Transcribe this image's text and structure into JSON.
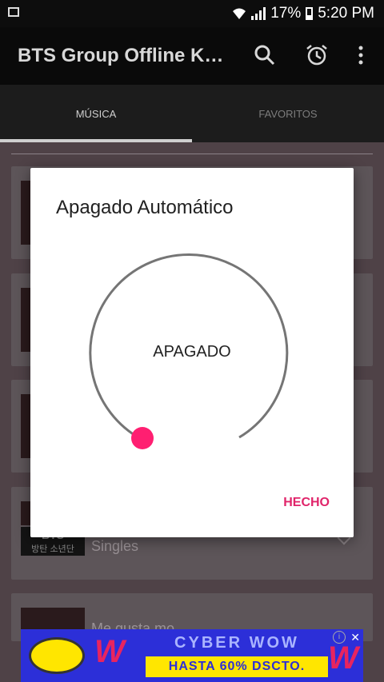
{
  "status_bar": {
    "battery_percent": "17%",
    "time": "5:20 PM"
  },
  "app_bar": {
    "title": "BTS Group Offline K…",
    "icons": [
      "search-icon",
      "alarm-icon",
      "more-vert-icon"
    ]
  },
  "tabs": [
    {
      "label": "MÚSICA",
      "selected": true
    },
    {
      "label": "FAVORITOS",
      "selected": false
    }
  ],
  "list": {
    "items": [
      {
        "label": ""
      },
      {
        "label": ""
      },
      {
        "label": ""
      },
      {
        "label": "Singles",
        "logo_text": "BTS\n방탄 소년단"
      },
      {
        "label": "Me gusta mo"
      }
    ]
  },
  "dialog": {
    "title": "Apagado Automático",
    "dial_value": "APAGADO",
    "done_label": "HECHO"
  },
  "ad": {
    "line1": "CYBER WOW",
    "line2": "HASTA 60% DSCTO."
  },
  "colors": {
    "accent": "#e0246a",
    "dialog_bg": "#ffffff",
    "appbar_bg": "#0a0a0a"
  }
}
